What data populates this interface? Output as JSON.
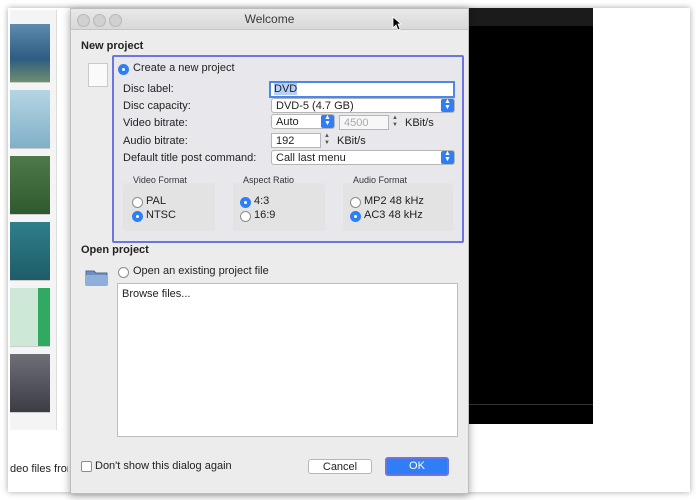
{
  "window": {
    "title": "Welcome"
  },
  "new_project": {
    "section_title": "New project",
    "create_label": "Create a new project",
    "disc_label": {
      "label": "Disc label:",
      "value": "DVD"
    },
    "disc_capacity": {
      "label": "Disc capacity:",
      "value": "DVD-5 (4.7 GB)"
    },
    "video_bitrate": {
      "label": "Video bitrate:",
      "mode": "Auto",
      "value": "4500",
      "unit": "KBit/s"
    },
    "audio_bitrate": {
      "label": "Audio bitrate:",
      "value": "192",
      "unit": "KBit/s"
    },
    "post_command": {
      "label": "Default title post command:",
      "value": "Call last menu"
    },
    "video_format": {
      "title": "Video Format",
      "options": [
        "PAL",
        "NTSC"
      ],
      "selected": "NTSC"
    },
    "aspect_ratio": {
      "title": "Aspect Ratio",
      "options": [
        "4:3",
        "16:9"
      ],
      "selected": "4:3"
    },
    "audio_format": {
      "title": "Audio Format",
      "options": [
        "MP2 48 kHz",
        "AC3 48 kHz"
      ],
      "selected": "AC3 48 kHz"
    }
  },
  "open_project": {
    "section_title": "Open project",
    "open_label": "Open an existing project file",
    "browse": "Browse files..."
  },
  "footer": {
    "dont_show": "Don't show this dialog again",
    "cancel": "Cancel",
    "ok": "OK"
  },
  "background": {
    "footer_text": "deo files from t"
  },
  "colors": {
    "accent": "#2f7ef6",
    "highlight": "#6c74e0"
  }
}
